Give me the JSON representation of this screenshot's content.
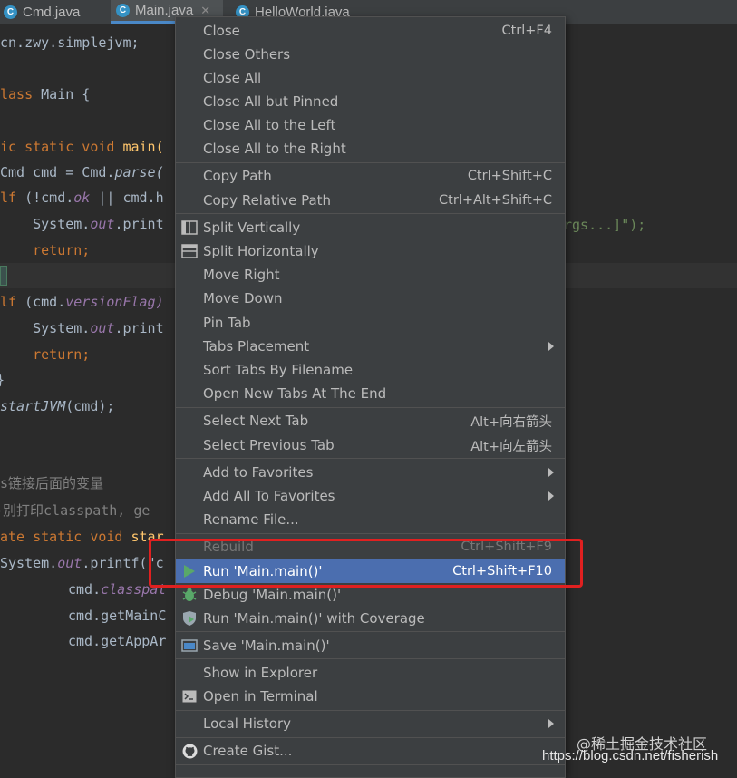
{
  "tabs": [
    {
      "name": "Cmd.java",
      "active": false
    },
    {
      "name": "Main.java",
      "active": true
    },
    {
      "name": "HelloWorld.java",
      "active": false
    }
  ],
  "code": {
    "l1": "cn.zwy.simplejvm;",
    "l2a": "lass",
    "l2b": " Main {",
    "l3a": "ic static void ",
    "l3b": "main(",
    "l4a": "Cmd cmd = Cmd.",
    "l4b": "parse(",
    "l5a": "lf",
    "l5b": " (!cmd.",
    "l5c": "ok",
    "l5d": " || cmd.h",
    "l5tail": "rgs...]\");",
    "l6a": "    System.",
    "l6b": "out",
    "l6c": ".print",
    "l7": "    return;",
    "l8a": "lf",
    "l8b": " (cmd.",
    "l8c": "versionFlag)",
    "l9a": "    System.",
    "l9b": "out",
    "l9c": ".print",
    "l10": "    return;",
    "l11": "}",
    "l12a": "startJVM",
    "l12b": "(cmd);",
    "l13": "s链接后面的变量",
    "l14": "}别打印classpath, ge",
    "l15a": "ate static void ",
    "l15b": "star",
    "l16a": "System.",
    "l16b": "out",
    "l16c": ".printf(\"c",
    "l17a": "cmd.",
    "l17b": "classpat",
    "l18": "cmd.getMainC",
    "l19": "cmd.getAppAr"
  },
  "menu": {
    "close": {
      "label": "Close",
      "shortcut": "Ctrl+F4"
    },
    "close_others": {
      "label": "Close Others"
    },
    "close_all": {
      "label": "Close All"
    },
    "close_all_but_pinned": {
      "label": "Close All but Pinned"
    },
    "close_all_left": {
      "label": "Close All to the Left"
    },
    "close_all_right": {
      "label": "Close All to the Right"
    },
    "copy_path": {
      "label": "Copy Path",
      "shortcut": "Ctrl+Shift+C"
    },
    "copy_relative_path": {
      "label": "Copy Relative Path",
      "shortcut": "Ctrl+Alt+Shift+C"
    },
    "split_vertically": {
      "label": "Split Vertically",
      "icon": "split-vertically-icon"
    },
    "split_horizontally": {
      "label": "Split Horizontally",
      "icon": "split-horizontally-icon"
    },
    "move_right": {
      "label": "Move Right"
    },
    "move_down": {
      "label": "Move Down"
    },
    "pin_tab": {
      "label": "Pin Tab"
    },
    "tabs_placement": {
      "label": "Tabs Placement"
    },
    "sort_tabs": {
      "label": "Sort Tabs By Filename"
    },
    "open_new_tabs_end": {
      "label": "Open New Tabs At The End"
    },
    "select_next_tab": {
      "label": "Select Next Tab",
      "shortcut": "Alt+向右箭头"
    },
    "select_prev_tab": {
      "label": "Select Previous Tab",
      "shortcut": "Alt+向左箭头"
    },
    "add_to_favorites": {
      "label": "Add to Favorites"
    },
    "add_all_to_favorites": {
      "label": "Add All To Favorites"
    },
    "rename_file": {
      "label": "Rename File..."
    },
    "rebuild": {
      "label": "Rebuild",
      "shortcut": "Ctrl+Shift+F9"
    },
    "run_main": {
      "label": "Run 'Main.main()'",
      "shortcut": "Ctrl+Shift+F10",
      "icon": "run-icon"
    },
    "debug_main": {
      "label": "Debug 'Main.main()'",
      "icon": "debug-icon"
    },
    "run_coverage": {
      "label": "Run 'Main.main()' with Coverage",
      "icon": "coverage-icon"
    },
    "save_main": {
      "label": "Save 'Main.main()'",
      "icon": "save-config-icon"
    },
    "show_in_explorer": {
      "label": "Show in Explorer"
    },
    "open_in_terminal": {
      "label": "Open in Terminal",
      "icon": "terminal-icon"
    },
    "local_history": {
      "label": "Local History"
    },
    "create_gist": {
      "label": "Create Gist...",
      "icon": "github-icon"
    }
  },
  "watermark": {
    "cn": "@稀土掘金技术社区",
    "url": "https://blog.csdn.net/fisherish"
  },
  "colors": {
    "editor_bg": "#2b2b2b",
    "menu_bg": "#3c3f41",
    "selection": "#4b6eaf",
    "highlight_box": "#e02020",
    "keyword": "#cc7832"
  }
}
